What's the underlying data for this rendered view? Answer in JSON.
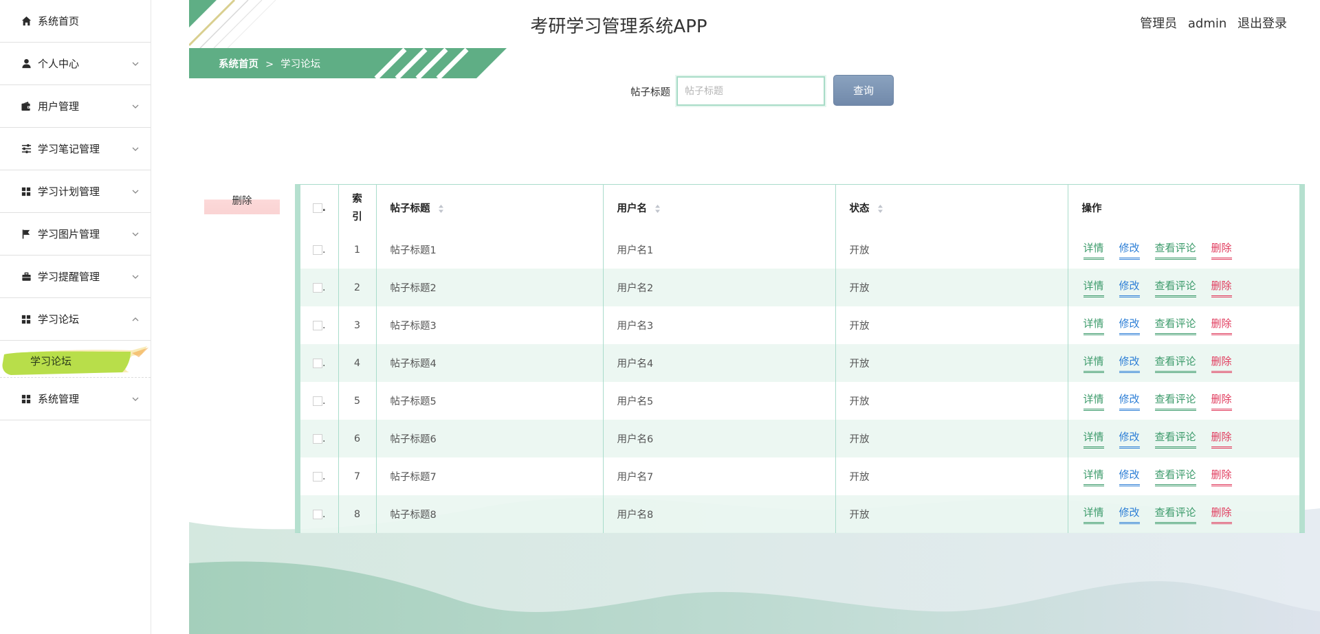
{
  "app": {
    "title": "考研学习管理系统APP",
    "user_role": "管理员",
    "username": "admin",
    "logout_label": "退出登录"
  },
  "sidebar": {
    "items": [
      {
        "label": "系统首页",
        "icon": "home-icon",
        "has_chevron": false
      },
      {
        "label": "个人中心",
        "icon": "user-icon",
        "has_chevron": true
      },
      {
        "label": "用户管理",
        "icon": "wallet-icon",
        "has_chevron": true
      },
      {
        "label": "学习笔记管理",
        "icon": "sliders-icon",
        "has_chevron": true
      },
      {
        "label": "学习计划管理",
        "icon": "grid-icon",
        "has_chevron": true
      },
      {
        "label": "学习图片管理",
        "icon": "flag-icon",
        "has_chevron": true
      },
      {
        "label": "学习提醒管理",
        "icon": "briefcase-icon",
        "has_chevron": true
      },
      {
        "label": "学习论坛",
        "icon": "grid-icon",
        "has_chevron": true,
        "expanded": true
      },
      {
        "label": "系统管理",
        "icon": "grid-icon",
        "has_chevron": true
      }
    ],
    "submenu_forum": {
      "label": "学习论坛",
      "active": true
    }
  },
  "breadcrumb": {
    "home": "系统首页",
    "separator": ">",
    "current": "学习论坛"
  },
  "search": {
    "label": "帖子标题",
    "placeholder": "帖子标题",
    "value": "",
    "button_label": "查询"
  },
  "batch_delete_label": "删除",
  "table": {
    "headers": {
      "index": "索引",
      "title": "帖子标题",
      "username": "用户名",
      "status": "状态",
      "actions": "操作"
    },
    "action_labels": {
      "detail": "详情",
      "edit": "修改",
      "comments": "查看评论",
      "delete": "删除"
    },
    "rows": [
      {
        "index": "1",
        "title": "帖子标题1",
        "username": "用户名1",
        "status": "开放"
      },
      {
        "index": "2",
        "title": "帖子标题2",
        "username": "用户名2",
        "status": "开放"
      },
      {
        "index": "3",
        "title": "帖子标题3",
        "username": "用户名3",
        "status": "开放"
      },
      {
        "index": "4",
        "title": "帖子标题4",
        "username": "用户名4",
        "status": "开放"
      },
      {
        "index": "5",
        "title": "帖子标题5",
        "username": "用户名5",
        "status": "开放"
      },
      {
        "index": "6",
        "title": "帖子标题6",
        "username": "用户名6",
        "status": "开放"
      },
      {
        "index": "7",
        "title": "帖子标题7",
        "username": "用户名7",
        "status": "开放"
      },
      {
        "index": "8",
        "title": "帖子标题8",
        "username": "用户名8",
        "status": "开放"
      }
    ]
  },
  "colors": {
    "brand_green": "#5fae85",
    "active_submenu": "#b8de4a",
    "search_button": "#7d95b5",
    "link_green": "#3b9a6a",
    "link_blue": "#2e7fd6",
    "link_red": "#e03a5c"
  }
}
